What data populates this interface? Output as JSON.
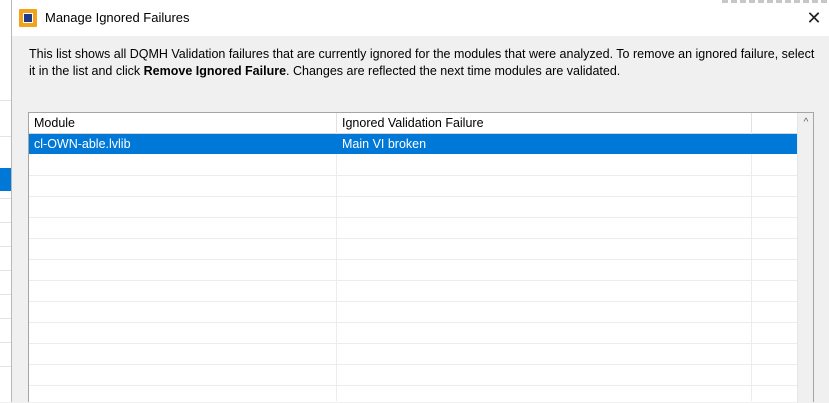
{
  "dialog": {
    "title": "Manage Ignored Failures",
    "close_glyph": "✕",
    "description_part1": "This list shows all DQMH Validation failures that are currently ignored for the modules that were analyzed. To remove an ignored failure, select it in the list and click ",
    "description_bold": "Remove Ignored Failure",
    "description_part2": ". Changes are reflected the next time modules are validated."
  },
  "list": {
    "columns": [
      "Module",
      "Ignored Validation Failure"
    ],
    "rows": [
      {
        "module": "cl-OWN-able.lvlib",
        "failure": "Main VI broken",
        "selected": true
      }
    ],
    "scroll_up_glyph": "^"
  },
  "colors": {
    "selection": "#0078d7",
    "app_icon": "#f5a21b"
  },
  "icons": [
    "app-icon",
    "close-icon",
    "scroll-up-icon"
  ]
}
